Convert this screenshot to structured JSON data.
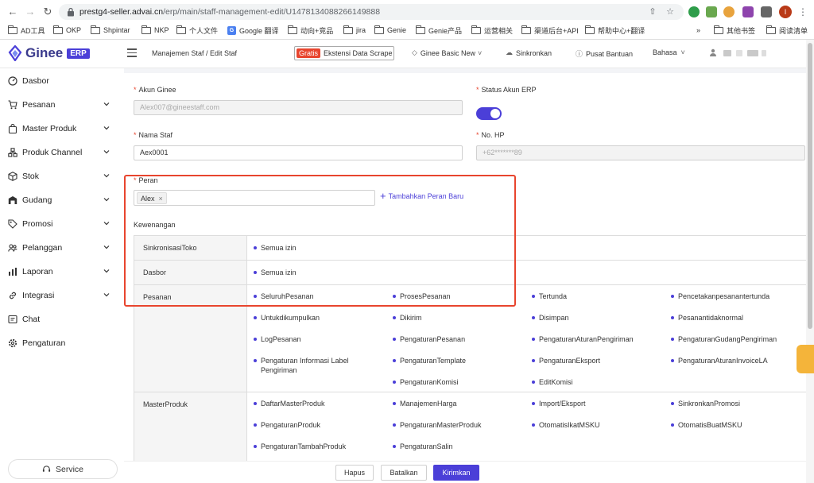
{
  "browser": {
    "url_host": "prestg4-seller.advai.cn",
    "url_path": "/erp/main/staff-management-edit/U1478134088266149888",
    "profile_initial": "I",
    "bookmarks": [
      "AD工具",
      "OKP",
      "Shpintar",
      "NKP",
      "个人文件",
      "Google 翻译",
      "动向+竞品",
      "jira",
      "Genie",
      "Genie产品",
      "运营相关",
      "渠道后台+API",
      "帮助中心+翻译"
    ],
    "bookmarks_more": "»",
    "other_bookmarks": "其他书签",
    "reading_list": "阅读清单"
  },
  "app": {
    "logo_text": "Ginee",
    "logo_badge": "ERP",
    "breadcrumb": "Manajemen Staf / Edit Staf",
    "promo_badge": "Gratis",
    "promo_text": "Ekstensi Data Scrape",
    "plan": "Ginee Basic New",
    "sync": "Sinkronkan",
    "help": "Pusat Bantuan",
    "language": "Bahasa",
    "colors": {
      "primary": "#4b3fd8",
      "highlight": "#e8452e"
    }
  },
  "sidebar": {
    "items": [
      {
        "label": "Dasbor",
        "icon": "dashboard-icon",
        "expandable": false
      },
      {
        "label": "Pesanan",
        "icon": "cart-icon",
        "expandable": true
      },
      {
        "label": "Master Produk",
        "icon": "bag-icon",
        "expandable": true
      },
      {
        "label": "Produk Channel",
        "icon": "channel-icon",
        "expandable": true
      },
      {
        "label": "Stok",
        "icon": "box-icon",
        "expandable": true
      },
      {
        "label": "Gudang",
        "icon": "warehouse-icon",
        "expandable": true
      },
      {
        "label": "Promosi",
        "icon": "tag-icon",
        "expandable": true
      },
      {
        "label": "Pelanggan",
        "icon": "users-icon",
        "expandable": true
      },
      {
        "label": "Laporan",
        "icon": "chart-icon",
        "expandable": true
      },
      {
        "label": "Integrasi",
        "icon": "link-icon",
        "expandable": true
      },
      {
        "label": "Chat",
        "icon": "chat-icon",
        "expandable": false
      },
      {
        "label": "Pengaturan",
        "icon": "gear-icon",
        "expandable": false
      }
    ],
    "service_label": "Service"
  },
  "form": {
    "akun_label": "Akun Ginee",
    "akun_placeholder": "Alex007@gineestaff.com",
    "status_label": "Status Akun ERP",
    "status_on": true,
    "nama_label": "Nama Staf",
    "nama_value": "Aex0001",
    "hp_label": "No. HP",
    "hp_value": "+62*******89",
    "peran_label": "Peran",
    "peran_tag": "Alex",
    "add_role": "Tambahkan Peran Baru",
    "kewenangan_label": "Kewenangan"
  },
  "permissions": [
    {
      "category": "SinkronisasiToko",
      "items": [
        "Semua izin"
      ]
    },
    {
      "category": "Dasbor",
      "items": [
        "Semua izin"
      ]
    },
    {
      "category": "Pesanan",
      "items": [
        "SeluruhPesanan",
        "ProsesPesanan",
        "Tertunda",
        "Pencetakanpesanantertunda",
        "Untukdikumpulkan",
        "Dikirim",
        "Disimpan",
        "Pesanantidaknormal",
        "LogPesanan",
        "PengaturanPesanan",
        "PengaturanAturanPengiriman",
        "PengaturanGudangPengiriman",
        "Pengaturan Informasi Label Pengiriman",
        "PengaturanTemplate",
        "PengaturanEksport",
        "PengaturanAturanInvoiceLA",
        "",
        "PengaturanKomisi",
        "EditKomisi"
      ]
    },
    {
      "category": "MasterProduk",
      "items": [
        "DaftarMasterProduk",
        "ManajemenHarga",
        "Import/Eksport",
        "SinkronkanPromosi",
        "PengaturanProduk",
        "PengaturanMasterProduk",
        "OtomatisIkatMSKU",
        "OtomatisBuatMSKU",
        "PengaturanTambahProduk",
        "PengaturanSalin"
      ]
    }
  ],
  "footer": {
    "delete": "Hapus",
    "cancel": "Batalkan",
    "submit": "Kirimkan"
  }
}
